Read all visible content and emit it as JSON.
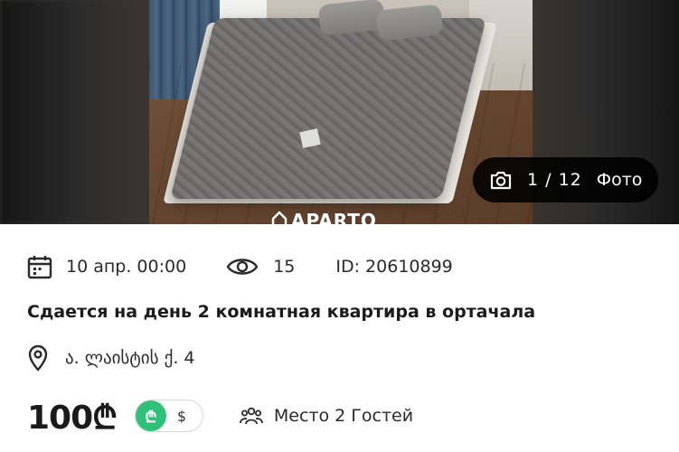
{
  "photo": {
    "counter": "1 / 12",
    "label": "Фото",
    "watermark": "APARTO"
  },
  "listing": {
    "date": "10 апр. 00:00",
    "views": "15",
    "id": "ID: 20610899",
    "title": "Сдается на день 2 комнатная квартира в ортачала",
    "address": "ა. ლაისტის ქ. 4",
    "price": "100₾",
    "currency_gel": "₾",
    "currency_usd": "$",
    "guests": "Место 2 Гостей"
  },
  "colors": {
    "gel_toggle": "#2fc17a",
    "photo_badge": "#000000"
  },
  "icons": [
    "calendar-icon",
    "eye-icon",
    "location-pin-icon",
    "camera-icon",
    "people-icon",
    "home-logo-icon"
  ]
}
